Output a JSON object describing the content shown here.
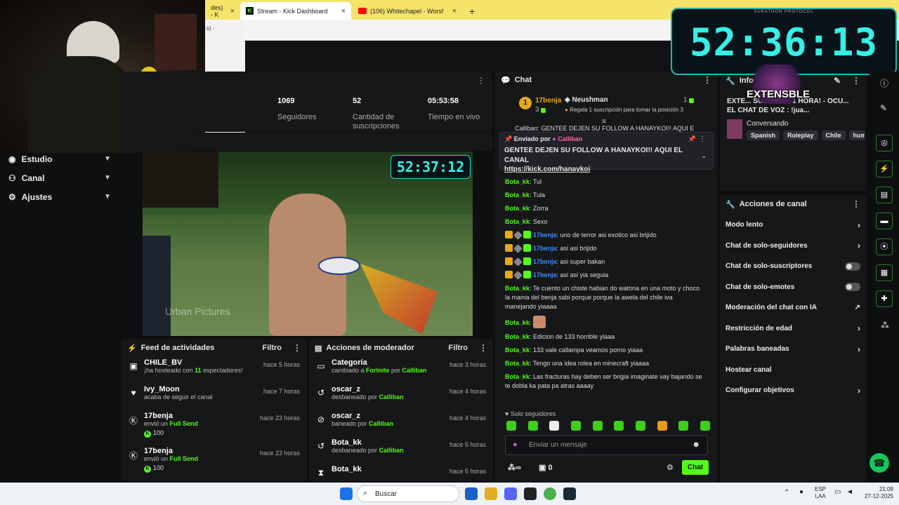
{
  "browser": {
    "tabs": [
      {
        "label": "des) - K"
      },
      {
        "label": "Stream - Kick Dashboard",
        "active": true
      },
      {
        "label": "(106) Whitechapel - Worshi"
      }
    ],
    "popup_text": "s) -"
  },
  "nav": {
    "items": [
      {
        "label": "Estudio"
      },
      {
        "label": "Canal"
      },
      {
        "label": "Ajustes"
      }
    ]
  },
  "stats": [
    {
      "value": "1069",
      "label": "Seguidores"
    },
    {
      "value": "52",
      "label": "Cantidad de suscripciones"
    },
    {
      "value": "05:53:58",
      "label": "Tiempo en vivo"
    }
  ],
  "video": {
    "overlay_timer": "52:37:12",
    "watermark": "Urban Pictures"
  },
  "activity": {
    "title": "Feed de actividades",
    "filter": "Filtro",
    "items": [
      {
        "name": "CHILE_BV",
        "time": "hace 5 horas",
        "pre": "¡ha hosteado con ",
        "hl": "11",
        "post": " espectadores!",
        "icon": "host-icon"
      },
      {
        "name": "Ivy_Moon",
        "time": "hace 7 horas",
        "pre": "acaba de seguir el canal",
        "hl": "",
        "post": "",
        "icon": "heart-icon"
      },
      {
        "name": "17benja",
        "time": "hace 23 horas",
        "pre": "envió un ",
        "hl": "Full Send",
        "post": "",
        "amount": "100",
        "icon": "kick-icon"
      },
      {
        "name": "17benja",
        "time": "hace 23 horas",
        "pre": "envió un ",
        "hl": "Full Send",
        "post": "",
        "amount": "100",
        "icon": "kick-icon"
      }
    ]
  },
  "modactions": {
    "title": "Acciones de moderador",
    "filter": "Filtro",
    "items": [
      {
        "name": "Categoría",
        "time": "hace 3 horas",
        "pre": "cambiado a ",
        "hl": "Fortnite",
        "mid": " por ",
        "by": "Calliban"
      },
      {
        "name": "oscar_z",
        "time": "hace 4 horas",
        "pre": "desbaneado por ",
        "hl": "",
        "mid": "",
        "by": "Calliban"
      },
      {
        "name": "oscar_z",
        "time": "hace 4 horas",
        "pre": "baneado por ",
        "hl": "",
        "mid": "",
        "by": "Calliban"
      },
      {
        "name": "Bota_kk",
        "time": "hace 5 horas",
        "pre": "desbaneado por ",
        "hl": "",
        "mid": "",
        "by": "Calliban"
      },
      {
        "name": "Bota_kk",
        "time": "hace 5 horas",
        "pre": "",
        "hl": "",
        "mid": "",
        "by": ""
      }
    ]
  },
  "chat": {
    "title": "Chat",
    "leader": {
      "rank": "1",
      "user": "17benja",
      "count": "3",
      "second": "Neushman",
      "second_count": "1",
      "gift_text": "Regala 1 suscripción para tomar la posición 3"
    },
    "pinned": {
      "sender_label": "Enviado por",
      "sender": "Calliban",
      "text": "GENTEE DEJEN SU FOLLOW A HANAYKOI!! AQUI EL CANAL",
      "link": "https://kick.com/hanaykoi",
      "behind": "Calliban: GENTEE DEJEN SU FOLLOW A HANAYKOI!! AQUI EL"
    },
    "messages": [
      {
        "user": "Bota_kk",
        "text": "Tul",
        "badges": false
      },
      {
        "user": "Bota_kk",
        "text": "Tula",
        "badges": false
      },
      {
        "user": "Bota_kk",
        "text": "Zorra",
        "badges": false
      },
      {
        "user": "Bota_kk",
        "text": "Sexo",
        "badges": false
      },
      {
        "user": "17benja",
        "text": "uno de terror asi exotico asi brijido",
        "badges": true
      },
      {
        "user": "17benja",
        "text": "asi asi brijido",
        "badges": true
      },
      {
        "user": "17benja",
        "text": "asi super bakan",
        "badges": true
      },
      {
        "user": "17benja",
        "text": "asi asi yia seguia",
        "badges": true
      },
      {
        "user": "Bota_kk",
        "text": "Te cuento un chiste habian do watona en una moto y choco la mama del benja sabi porque porque la awela del chile iva manejando yiaaaa",
        "badges": false
      },
      {
        "user": "Bota_kk",
        "text": "",
        "badges": false,
        "emote": true
      },
      {
        "user": "Bota_kk",
        "text": "Edicion de 133 horrible yiaaa",
        "badges": false
      },
      {
        "user": "Bota_kk",
        "text": "133 vale callampa veamos porno yiaaa",
        "badges": false
      },
      {
        "user": "Bota_kk",
        "text": "Tengo una idea rolea en minecraft yiaaaa",
        "badges": false
      },
      {
        "user": "Bota_kk",
        "text": "Las fracturas hay deben ser brigia imaginate vay bajando se te dobla ka pata pa atras aaaay",
        "badges": false
      }
    ],
    "mode": "Solo seguidores",
    "input_placeholder": "Enviar un mensaje",
    "infinity": "∞",
    "gift_count": "0",
    "send": "Chat"
  },
  "info": {
    "title": "Info",
    "stream_title": "EXTE... SUB SUMA 1 HORA! - OCU... EL CHAT DE VOZ : !jua...",
    "category": "Conversando",
    "tags": [
      "Spanish",
      "Roleplay",
      "Chile",
      "humor"
    ],
    "overlay_brand": "EXTENSBLE"
  },
  "actions": {
    "title": "Acciones de canal",
    "items": [
      {
        "label": "Modo lento",
        "kind": "chevron"
      },
      {
        "label": "Chat de solo-seguidores",
        "kind": "chevron"
      },
      {
        "label": "Chat de solo-suscriptores",
        "kind": "toggle"
      },
      {
        "label": "Chat de solo-emotes",
        "kind": "toggle"
      },
      {
        "label": "Moderación del chat con IA",
        "kind": "external"
      },
      {
        "label": "Restricción de edad",
        "kind": "chevron"
      },
      {
        "label": "Palabras baneadas",
        "kind": "chevron"
      },
      {
        "label": "Hostear canal",
        "kind": "none"
      },
      {
        "label": "Configurar objetivos",
        "kind": "chevron"
      }
    ]
  },
  "overlay": {
    "timer": "52:36:13",
    "label": "SUBATHON PROTOCOL"
  },
  "taskbar": {
    "search": "Buscar",
    "lang": "ESP",
    "lang2": "LAA",
    "time": "21:09",
    "date": "27-12-2025"
  },
  "colors": {
    "accent": "#53fc18",
    "timer": "#35f0e6",
    "panel": "#161719"
  }
}
